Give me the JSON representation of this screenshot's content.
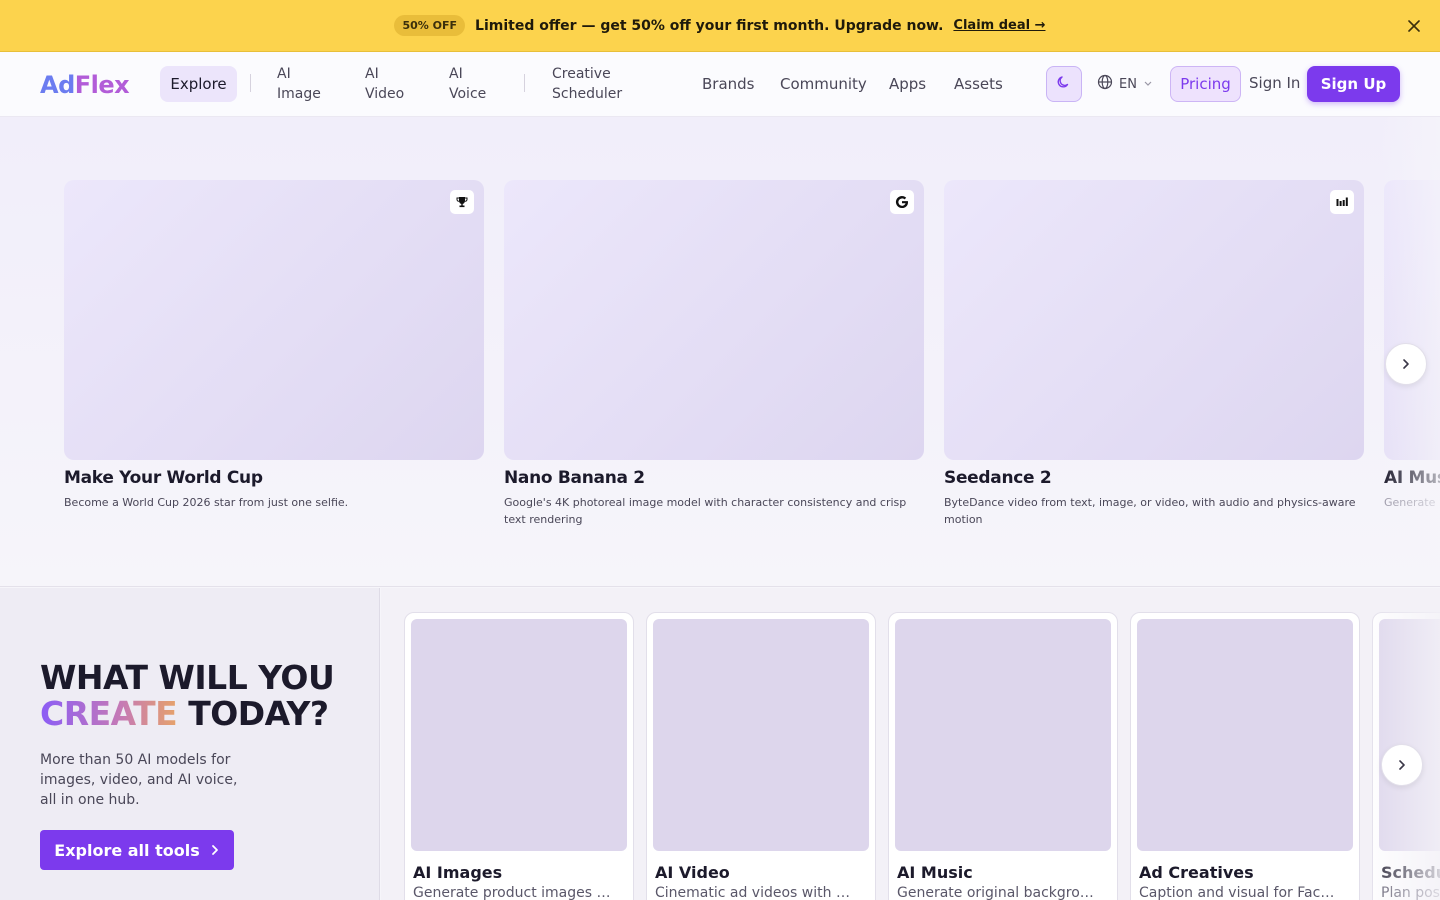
{
  "promo": {
    "badge": "50% OFF",
    "text": "Limited offer — get 50% off your first month. Upgrade now.",
    "link": "Claim deal →",
    "close_icon": "close-icon"
  },
  "nav": {
    "logo": {
      "a": "Ad",
      "f": "Flex"
    },
    "explore": "Explore",
    "ai_image": [
      "AI",
      "Image"
    ],
    "ai_video": [
      "AI",
      "Video"
    ],
    "ai_voice": [
      "AI",
      "Voice"
    ],
    "creative_scheduler": [
      "Creative",
      "Scheduler"
    ],
    "brands": "Brands",
    "community": "Community",
    "apps": "Apps",
    "assets": "Assets",
    "theme_icon": "moon-icon",
    "lang": "EN",
    "pricing": "Pricing",
    "sign_in": "Sign In",
    "sign_up": "Sign Up"
  },
  "hero": {
    "cards": [
      {
        "title": "Make Your World Cup",
        "desc": "Become a World Cup 2026 star from just one selfie.",
        "badge_icon": "trophy-icon"
      },
      {
        "title": "Nano Banana 2",
        "desc": "Google's 4K photoreal image model with character consistency and crisp text rendering",
        "badge_icon": "google-icon"
      },
      {
        "title": "Seedance 2",
        "desc": "ByteDance video from text, image, or video, with audio and physics-aware motion",
        "badge_icon": "bytedance-icon"
      },
      {
        "title": "AI Music",
        "desc": "Generate"
      }
    ],
    "next_icon": "chevron-right-icon"
  },
  "tools": {
    "headline_line1": "WHAT WILL YOU",
    "headline_grad": "CREATE",
    "headline_rest": " TODAY?",
    "subtitle": "More than 50 AI models for images, video, and AI voice, all in one hub.",
    "cta": "Explore all tools",
    "items": [
      {
        "title": "AI Images",
        "desc": "Generate product images with AI"
      },
      {
        "title": "AI Video",
        "desc": "Cinematic ad videos with Veo"
      },
      {
        "title": "AI Music",
        "desc": "Generate original background music"
      },
      {
        "title": "Ad Creatives",
        "desc": "Caption and visual for Facebook"
      },
      {
        "title": "Schedule",
        "desc": "Plan posts"
      }
    ]
  },
  "colors": {
    "accent": "#7c3aed",
    "banner": "#fcd34d"
  }
}
